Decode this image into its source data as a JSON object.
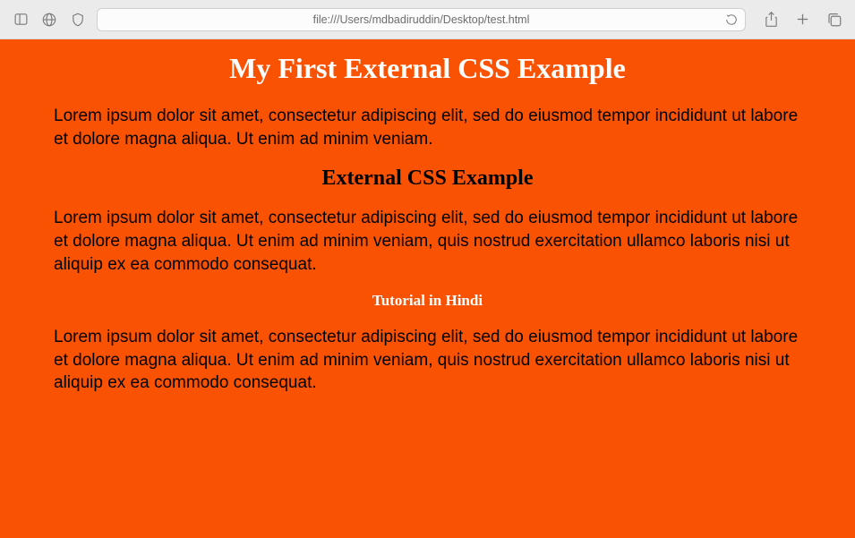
{
  "browser": {
    "address": "file:///Users/mdbadiruddin/Desktop/test.html"
  },
  "page": {
    "h1": "My First External CSS Example",
    "p1": "Lorem ipsum dolor sit amet, consectetur adipiscing elit, sed do eiusmod tempor incididunt ut labore et dolore magna aliqua. Ut enim ad minim veniam.",
    "h2": "External CSS Example",
    "p2": "Lorem ipsum dolor sit amet, consectetur adipiscing elit, sed do eiusmod tempor incididunt ut labore et dolore magna aliqua. Ut enim ad minim veniam, quis nostrud exercitation ullamco laboris nisi ut aliquip ex ea commodo consequat.",
    "h3": "Tutorial in Hindi",
    "p3": "Lorem ipsum dolor sit amet, consectetur adipiscing elit, sed do eiusmod tempor incididunt ut labore et dolore magna aliqua. Ut enim ad minim veniam, quis nostrud exercitation ullamco laboris nisi ut aliquip ex ea commodo consequat."
  },
  "colors": {
    "page_bg": "#fa5203",
    "h1_color": "#ffffff",
    "h3_color": "#ffffff",
    "text_color": "#000000"
  }
}
